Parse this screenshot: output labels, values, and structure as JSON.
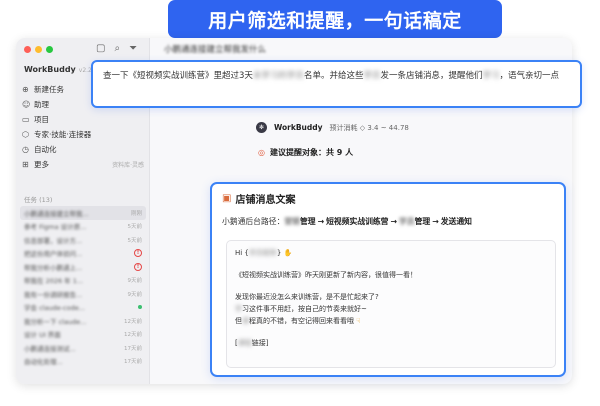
{
  "banner": {
    "text": "用户筛选和提醒，一句话稿定"
  },
  "window": {
    "dots": [
      "#fe5f57",
      "#febc2e",
      "#28c840"
    ]
  },
  "sidebar": {
    "app_name": "WorkBuddy",
    "version": "v2.2.6",
    "nav": [
      {
        "icon": "plus-circle-icon",
        "label": "新建任务"
      },
      {
        "icon": "robot-icon",
        "label": "助理"
      },
      {
        "icon": "folder-icon",
        "label": "项目"
      },
      {
        "icon": "puzzle-icon",
        "label": "专家·技能·连接器"
      },
      {
        "icon": "clock-icon",
        "label": "自动化"
      },
      {
        "icon": "grid-icon",
        "label": "更多",
        "sub": "资料库·灵感"
      }
    ],
    "tasks_header": "任务 (13)",
    "tasks": [
      {
        "title": "小鹏通连接建立帮我...",
        "time": "刚刚",
        "status": "active"
      },
      {
        "title": "参考 Figma 设计原...",
        "time": "5天前",
        "status": ""
      },
      {
        "title": "信息部署，设计方...",
        "time": "5天前",
        "status": ""
      },
      {
        "title": "把这份用户体验问...",
        "time": "",
        "status": "warn"
      },
      {
        "title": "帮我分析小鹏通上...",
        "time": "",
        "status": "warn"
      },
      {
        "title": "帮我在 2026 年 1...",
        "time": "9天前",
        "status": ""
      },
      {
        "title": "我有一份调研报告...",
        "time": "9天前",
        "status": ""
      },
      {
        "title": "学会 claude-code...",
        "time": "",
        "status": "green"
      },
      {
        "title": "我分析一下 claude...",
        "time": "12天前",
        "status": ""
      },
      {
        "title": "设计 UI 界面",
        "time": "12天前",
        "status": ""
      },
      {
        "title": "小鹏通连接测试...",
        "time": "17天前",
        "status": ""
      },
      {
        "title": "自动化处理...",
        "time": "17天前",
        "status": ""
      }
    ]
  },
  "main": {
    "conv_title": "小鹏通连接建立帮我发什么",
    "prompt": {
      "seg1": "查一下《短视频实战训练营》里超过3天",
      "seg2": "未学习的学员",
      "seg3": "名单。并给这些",
      "seg4": "学员",
      "seg5": "发一条店铺消息，提醒他们",
      "seg6": "学习",
      "seg7": "，语气亲切一点"
    },
    "agent_name": "WorkBuddy",
    "cost": "预计消耗 ◇ 3.4 ~ 44.78",
    "target": "建议提醒对象：共 9 人"
  },
  "panel": {
    "title": "店铺消息文案",
    "path_label": "小鹅通后台路径：",
    "path_b1": "营销",
    "path_s1": "管理",
    "path_s2": "短视频实战训练营",
    "path_b2": "学员",
    "path_s3": "管理",
    "path_s4": "发送通知",
    "msg": {
      "l1a": "Hi {",
      "l1b": "学员昵称",
      "l1c": "}",
      "l2": "《短视频实战训练营》昨天刚更新了新内容，很值得一看！",
      "l3": "发现你最近没怎么来训练营，是不是忙起来了?",
      "l4a": "学",
      "l4b": "习这件事不用赶，按自己的节奏来就好~",
      "l5a": "但",
      "l5b": "课",
      "l5c": "程真的不错，有空记得回来看看哦",
      "l6a": "[",
      "l6b": "课程",
      "l6c": "链接]"
    }
  }
}
